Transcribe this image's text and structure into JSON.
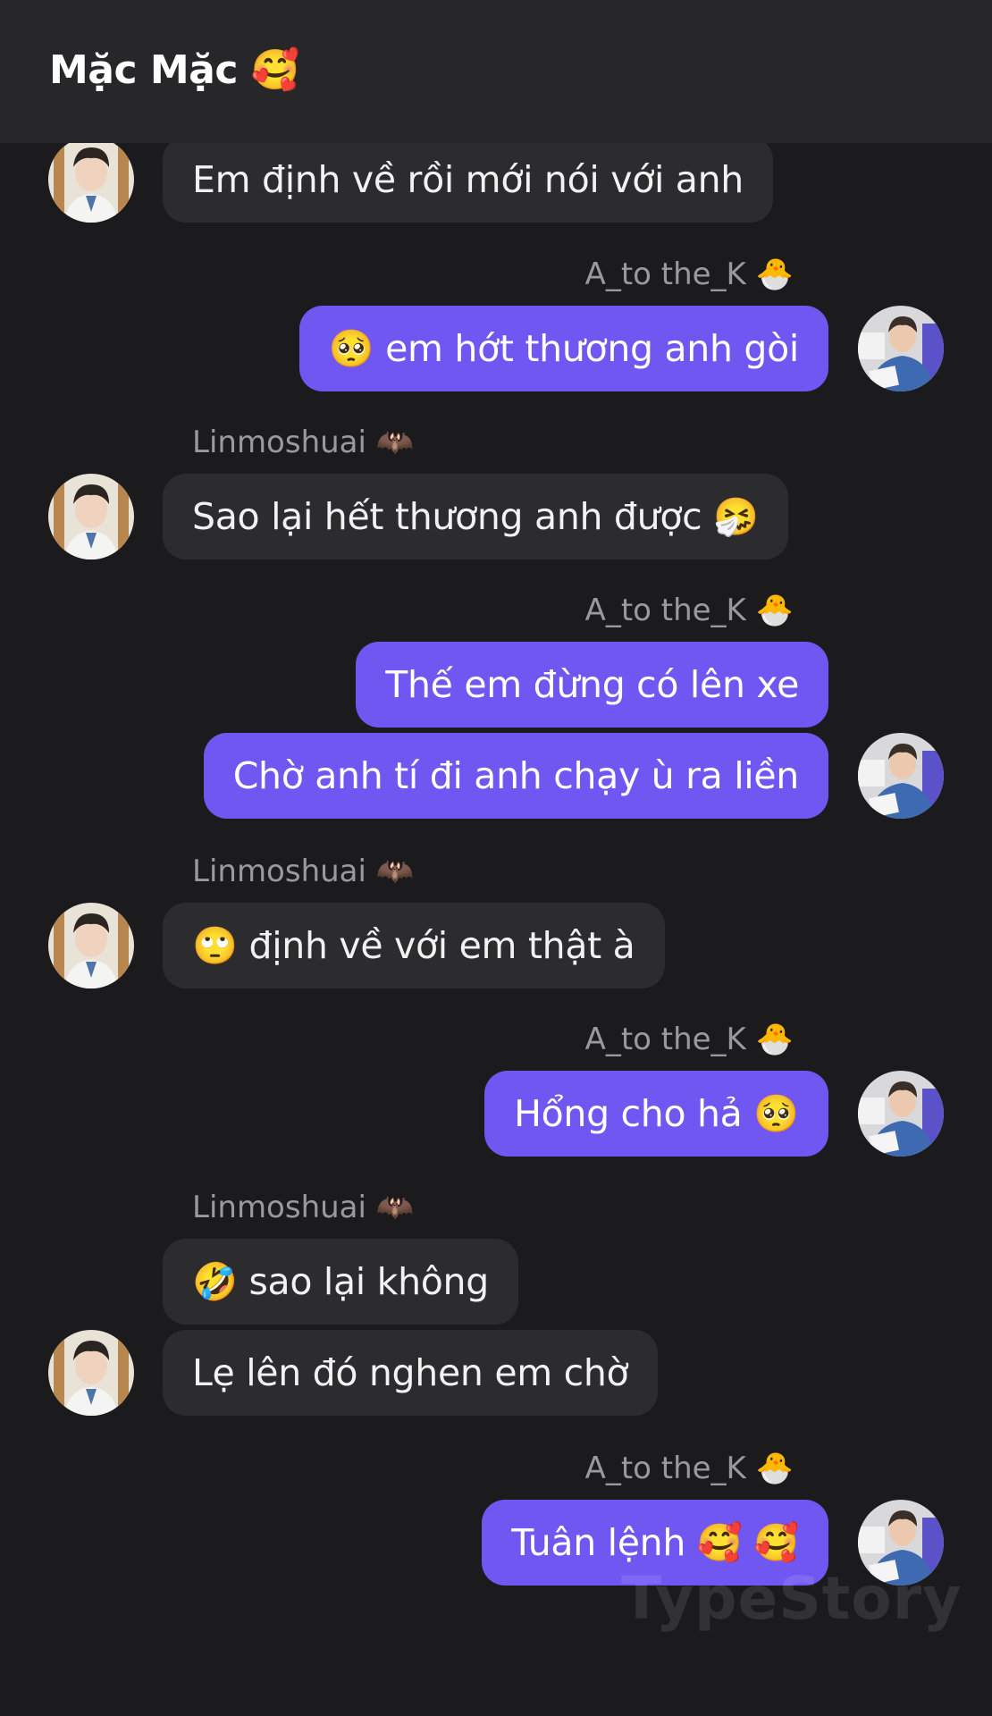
{
  "header": {
    "title": "Mặc Mặc 🥰"
  },
  "messages": [
    {
      "side": "left",
      "sender": "",
      "text": "Em định về rồi mới nói với anh"
    },
    {
      "side": "right",
      "sender": "A_to the_K 🐣",
      "text": "🥺 em hớt thương anh gòi"
    },
    {
      "side": "left",
      "sender": "Linmoshuai 🦇",
      "text": "Sao lại hết thương anh được 🤧"
    },
    {
      "side": "right",
      "sender": "A_to the_K 🐣",
      "text": "Thế em đừng có lên xe"
    },
    {
      "side": "right",
      "sender": "",
      "text": "Chờ anh tí đi anh chạy ù ra liền"
    },
    {
      "side": "left",
      "sender": "Linmoshuai 🦇",
      "text": "🙄 định về với em thật à"
    },
    {
      "side": "right",
      "sender": "A_to the_K 🐣",
      "text": "Hổng cho hả 🥺"
    },
    {
      "side": "left",
      "sender": "Linmoshuai 🦇",
      "text": "🤣 sao lại không"
    },
    {
      "side": "left",
      "sender": "",
      "text": "Lẹ lên đó nghen em chờ"
    },
    {
      "side": "right",
      "sender": "A_to the_K 🐣",
      "text": "Tuân lệnh 🥰 🥰"
    }
  ],
  "senders": {
    "left": "Linmoshuai 🦇",
    "right": "A_to the_K 🐣"
  },
  "watermark": "TypeStory",
  "colors": {
    "background": "#1b1b1d",
    "header": "#272729",
    "incoming_bubble": "#2c2c2f",
    "outgoing_bubble": "#7157f2",
    "sender_text": "#9a9a9e"
  }
}
